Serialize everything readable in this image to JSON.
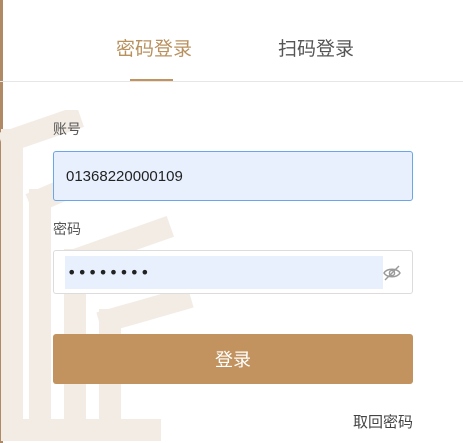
{
  "tabs": [
    {
      "label": "密码登录",
      "active": true
    },
    {
      "label": "扫码登录",
      "active": false
    }
  ],
  "form": {
    "account_label": "账号",
    "account_value": "01368220000109",
    "password_label": "密码",
    "password_value": "••••••••",
    "password_toggle_icon": "eye-off-icon",
    "submit_label": "登录",
    "forgot_label": "取回密码"
  },
  "colors": {
    "accent": "#c2935f",
    "active_tab": "#b8915f",
    "autofill_bg": "#e8f0fe",
    "focus_border": "#6aa6e8"
  }
}
